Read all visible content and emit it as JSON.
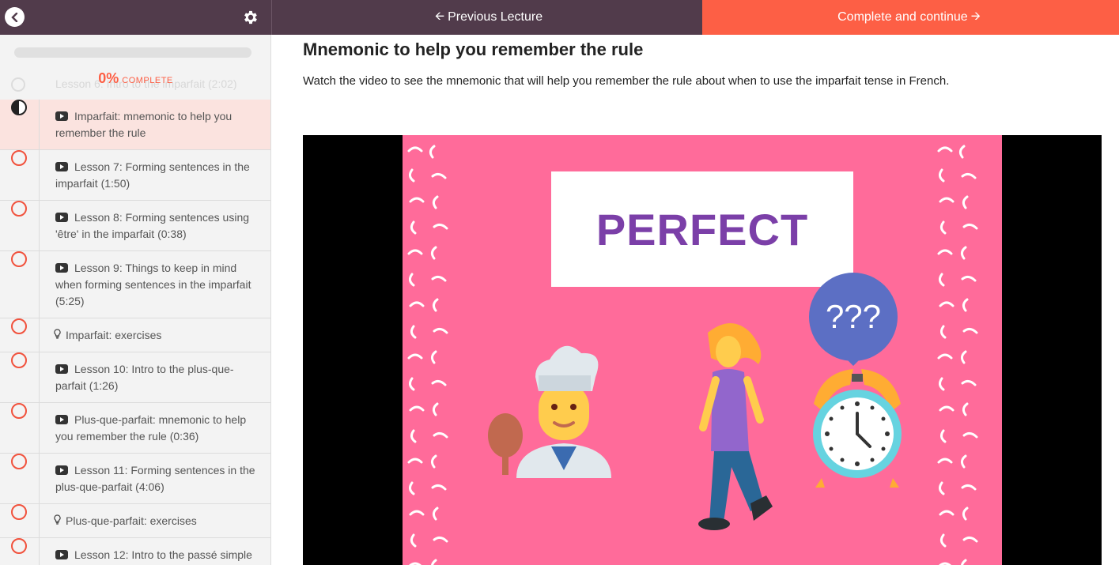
{
  "nav": {
    "prev_label": "Previous Lecture",
    "next_label": "Complete and continue"
  },
  "progress": {
    "percent": "0%",
    "label": "COMPLETE",
    "value": 0
  },
  "ghost_item": "Lesson 6: Intro to the imparfait (2:02)",
  "lessons": [
    {
      "type": "video",
      "title": "Imparfait: mnemonic to help you remember the rule",
      "active": true
    },
    {
      "type": "video",
      "title": "Lesson 7: Forming sentences in the imparfait (1:50)"
    },
    {
      "type": "video",
      "title": "Lesson 8: Forming sentences using 'être' in the imparfait (0:38)"
    },
    {
      "type": "video",
      "title": "Lesson 9: Things to keep in mind when forming sentences in the imparfait (5:25)"
    },
    {
      "type": "quiz",
      "title": "Imparfait: exercises"
    },
    {
      "type": "video",
      "title": "Lesson 10: Intro to the plus-que-parfait (1:26)"
    },
    {
      "type": "video",
      "title": "Plus-que-parfait: mnemonic to help you remember the rule (0:36)"
    },
    {
      "type": "video",
      "title": "Lesson 11: Forming sentences in the plus-que-parfait (4:06)"
    },
    {
      "type": "quiz",
      "title": "Plus-que-parfait: exercises"
    },
    {
      "type": "video",
      "title": "Lesson 12: Intro to the passé simple"
    }
  ],
  "lecture": {
    "title": "Mnemonic to help you remember the rule",
    "description": "Watch the video to see the mnemonic that will help you remember the rule about when to use the imparfait tense in French."
  },
  "video": {
    "slide_word": "PERFECT",
    "bubble_text": "???",
    "slide_color": "#ff6b9a",
    "word_color": "#7b3fa8"
  },
  "colors": {
    "accent": "#fd5f45",
    "header": "#513b4b",
    "active_row": "#fbe3df"
  }
}
